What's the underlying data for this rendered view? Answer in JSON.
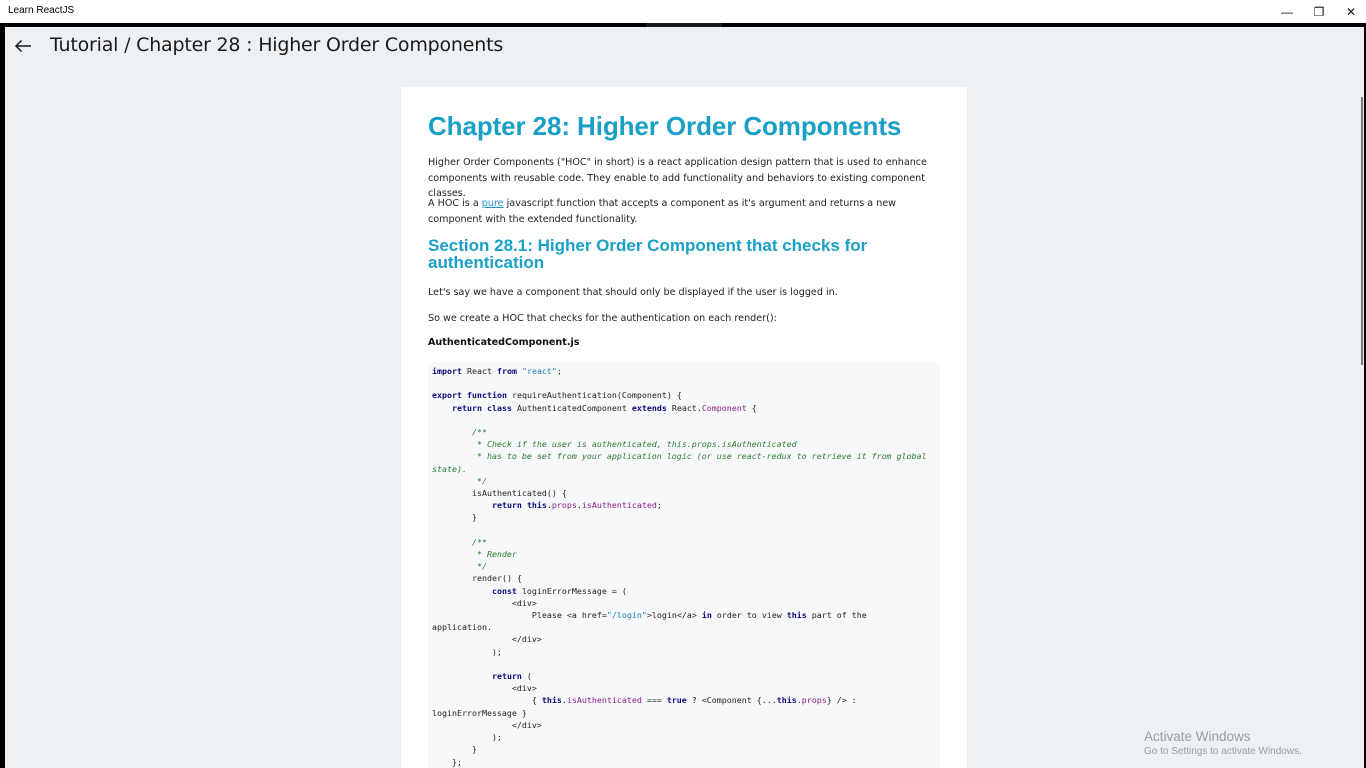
{
  "window": {
    "title": "Learn ReactJS",
    "minimize_glyph": "—",
    "maximize_glyph": "❐",
    "close_glyph": "✕"
  },
  "header": {
    "back_icon": "arrow-left-icon",
    "title": "Tutorial / Chapter 28 :  Higher Order Components"
  },
  "article": {
    "heading": "Chapter 28: Higher Order Components",
    "intro": "Higher Order Components (\"HOC\" in short) is a react application design pattern that is used to enhance components with reusable code. They enable to add functionality and behaviors to existing component classes.",
    "hoc_prefix": "A HOC is a ",
    "hoc_link": "pure",
    "hoc_suffix": " javascript function that accepts a component as it's argument and returns a new component with the extended functionality.",
    "section_heading": "Section 28.1: Higher Order Component that checks for authentication",
    "section_p1": "Let's say we have a component that should only be displayed if the user is logged in.",
    "section_p2": "So we create a HOC that checks for the authentication on each render():",
    "filename": "AuthenticatedComponent.js"
  },
  "code_lines": [
    "import React from \"react\";",
    "",
    "export function requireAuthentication(Component) {",
    "    return class AuthenticatedComponent extends React.Component {",
    "",
    "        /**",
    "         * Check if the user is authenticated, this.props.isAuthenticated",
    "         * has to be set from your application logic (or use react-redux to retrieve it from global",
    "state).",
    "         */",
    "        isAuthenticated() {",
    "            return this.props.isAuthenticated;",
    "        }",
    "",
    "        /**",
    "         * Render",
    "         */",
    "        render() {",
    "            const loginErrorMessage = (",
    "                <div>",
    "                    Please <a href=\"/login\">login</a> in order to view this part of the",
    "application.",
    "                </div>",
    "            );",
    "",
    "            return (",
    "                <div>",
    "                    { this.isAuthenticated === true ? <Component {...this.props} /> :",
    "loginErrorMessage }",
    "                </div>",
    "            );",
    "        }",
    "    };"
  ],
  "watermark": {
    "line1": "Activate Windows",
    "line2": "Go to Settings to activate Windows."
  },
  "colors": {
    "heading": "#1aa0c6",
    "link": "#1a8fc0",
    "keyword": "#0b0b7d",
    "string": "#1a7fae",
    "comment": "#2e7d32",
    "property": "#8a1e8a",
    "background": "#eef1f4"
  }
}
